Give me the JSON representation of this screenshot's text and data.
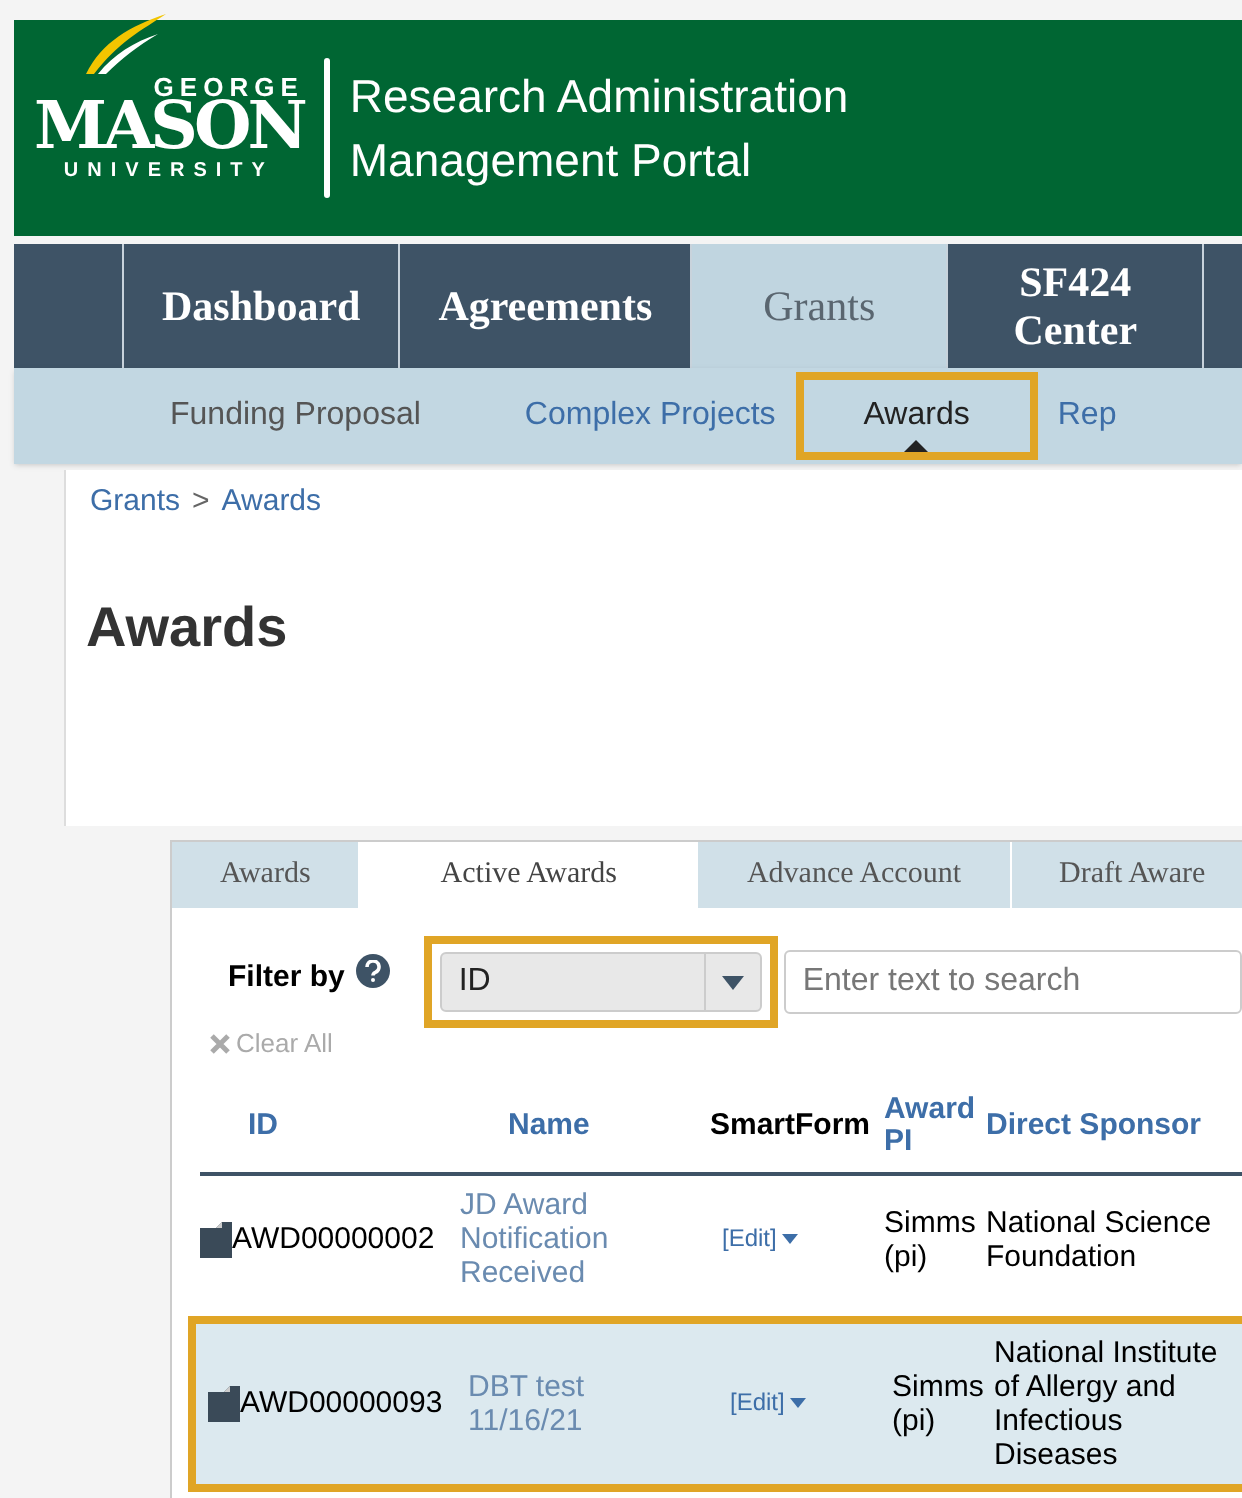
{
  "logo": {
    "top": "GEORGE",
    "main": "MASON",
    "bottom": "UNIVERSITY"
  },
  "portal_title": [
    "Research Administration",
    "Management Portal"
  ],
  "nav_tabs": [
    {
      "label": "Dashboard",
      "selected": false
    },
    {
      "label": "Agreements",
      "selected": false
    },
    {
      "label": "Grants",
      "selected": true
    },
    {
      "label": "SF424 Center",
      "selected": false
    }
  ],
  "sub_nav": [
    {
      "label": "Funding Proposal",
      "selected": false,
      "highlighted": false
    },
    {
      "label": "Complex Projects",
      "selected": false,
      "highlighted": false
    },
    {
      "label": "Awards",
      "selected": true,
      "highlighted": true
    },
    {
      "label": "Rep",
      "selected": false,
      "highlighted": false
    }
  ],
  "breadcrumb": [
    "Grants",
    ">",
    "Awards"
  ],
  "page_title": "Awards",
  "tabs": [
    {
      "label": "Awards",
      "selected": false
    },
    {
      "label": "Active Awards",
      "selected": true
    },
    {
      "label": "Advance Account",
      "selected": false
    },
    {
      "label": "Draft Aware",
      "selected": false
    }
  ],
  "filter": {
    "label": "Filter by",
    "select_value": "ID",
    "highlighted": true,
    "placeholder": "Enter text to search",
    "clear": "Clear All"
  },
  "table": {
    "columns": [
      {
        "label": "ID",
        "link": true
      },
      {
        "label": "Name",
        "link": true
      },
      {
        "label": "SmartForm",
        "link": false
      },
      {
        "label": "Award PI",
        "link": true
      },
      {
        "label": "Direct Sponsor",
        "link": true
      }
    ],
    "rows": [
      {
        "id": "AWD00000002",
        "name": "JD Award Notification Received",
        "smartform": "[Edit]",
        "pi": "Simms (pi)",
        "sponsor": "National Science Foundation",
        "highlighted": false
      },
      {
        "id": "AWD00000093",
        "name": "DBT test 11/16/21",
        "smartform": "[Edit]",
        "pi": "Simms (pi)",
        "sponsor": "National Institute of Allergy and Infectious Diseases",
        "highlighted": true
      }
    ]
  }
}
